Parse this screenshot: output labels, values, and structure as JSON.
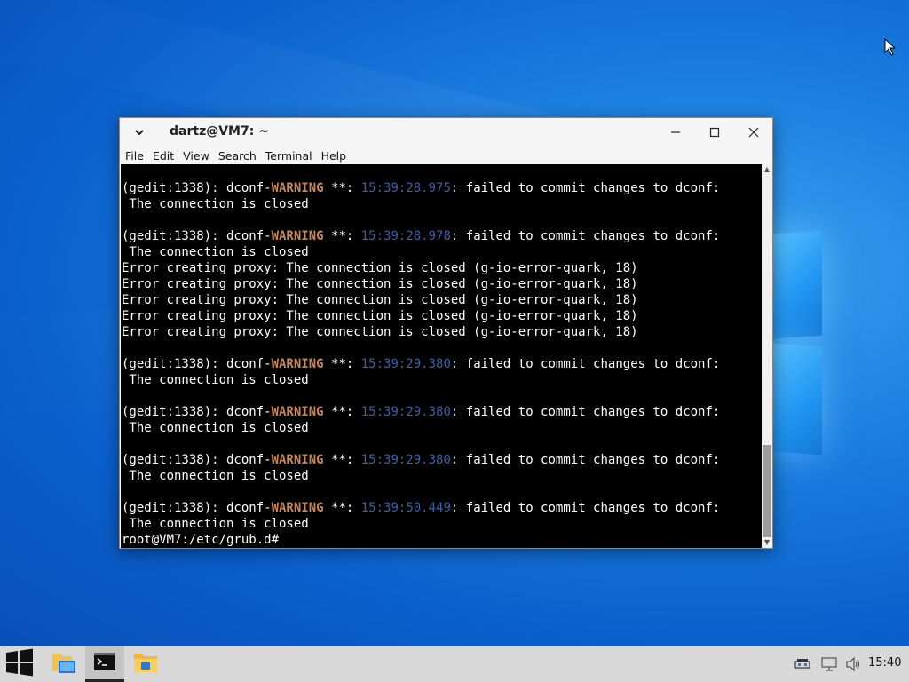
{
  "window": {
    "title": "dartz@VM7: ~",
    "menu": [
      "File",
      "Edit",
      "View",
      "Search",
      "Terminal",
      "Help"
    ]
  },
  "terminal": {
    "lines": [
      [
        {
          "t": "(gedit:1338): dconf-"
        },
        {
          "t": "WARNING",
          "c": "warn"
        },
        {
          "t": " **: "
        },
        {
          "t": "15:39:28.975",
          "c": "ts"
        },
        {
          "t": ": failed to commit changes to dconf:"
        }
      ],
      [
        {
          "t": " The connection is closed"
        }
      ],
      [
        {
          "t": ""
        }
      ],
      [
        {
          "t": "(gedit:1338): dconf-"
        },
        {
          "t": "WARNING",
          "c": "warn"
        },
        {
          "t": " **: "
        },
        {
          "t": "15:39:28.978",
          "c": "ts"
        },
        {
          "t": ": failed to commit changes to dconf:"
        }
      ],
      [
        {
          "t": " The connection is closed"
        }
      ],
      [
        {
          "t": "Error creating proxy: The connection is closed (g-io-error-quark, 18)"
        }
      ],
      [
        {
          "t": "Error creating proxy: The connection is closed (g-io-error-quark, 18)"
        }
      ],
      [
        {
          "t": "Error creating proxy: The connection is closed (g-io-error-quark, 18)"
        }
      ],
      [
        {
          "t": "Error creating proxy: The connection is closed (g-io-error-quark, 18)"
        }
      ],
      [
        {
          "t": "Error creating proxy: The connection is closed (g-io-error-quark, 18)"
        }
      ],
      [
        {
          "t": ""
        }
      ],
      [
        {
          "t": "(gedit:1338): dconf-"
        },
        {
          "t": "WARNING",
          "c": "warn"
        },
        {
          "t": " **: "
        },
        {
          "t": "15:39:29.380",
          "c": "ts"
        },
        {
          "t": ": failed to commit changes to dconf:"
        }
      ],
      [
        {
          "t": " The connection is closed"
        }
      ],
      [
        {
          "t": ""
        }
      ],
      [
        {
          "t": "(gedit:1338): dconf-"
        },
        {
          "t": "WARNING",
          "c": "warn"
        },
        {
          "t": " **: "
        },
        {
          "t": "15:39:29.380",
          "c": "ts"
        },
        {
          "t": ": failed to commit changes to dconf:"
        }
      ],
      [
        {
          "t": " The connection is closed"
        }
      ],
      [
        {
          "t": ""
        }
      ],
      [
        {
          "t": "(gedit:1338): dconf-"
        },
        {
          "t": "WARNING",
          "c": "warn"
        },
        {
          "t": " **: "
        },
        {
          "t": "15:39:29.380",
          "c": "ts"
        },
        {
          "t": ": failed to commit changes to dconf:"
        }
      ],
      [
        {
          "t": " The connection is closed"
        }
      ],
      [
        {
          "t": ""
        }
      ],
      [
        {
          "t": "(gedit:1338): dconf-"
        },
        {
          "t": "WARNING",
          "c": "warn"
        },
        {
          "t": " **: "
        },
        {
          "t": "15:39:50.449",
          "c": "ts"
        },
        {
          "t": ": failed to commit changes to dconf:"
        }
      ],
      [
        {
          "t": " The connection is closed"
        }
      ],
      [
        {
          "t": "root@VM7:/etc/grub.d#"
        }
      ]
    ],
    "colors": {
      "warning": "#c7855b",
      "timestamp": "#3c5fa6",
      "text": "#ffffff",
      "background": "#000000"
    }
  },
  "taskbar": {
    "items": [
      {
        "name": "start-button",
        "icon": "windows-logo-icon"
      },
      {
        "name": "file-manager-button",
        "icon": "folder-icon"
      },
      {
        "name": "terminal-button",
        "icon": "terminal-icon",
        "active": true
      },
      {
        "name": "explorer-button",
        "icon": "file-explorer-icon"
      }
    ],
    "tray": [
      "network-device-icon",
      "wired-network-icon",
      "volume-icon"
    ],
    "clock": "15:40"
  }
}
